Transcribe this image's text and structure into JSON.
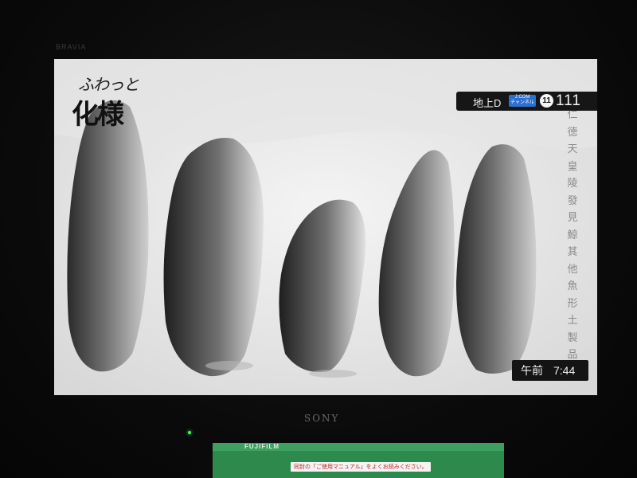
{
  "tv": {
    "brand": "SONY",
    "model_label": "BRAVIA"
  },
  "program": {
    "logo_small": "ふわっと",
    "logo_big": "化様",
    "caption_vertical": "仁徳天皇陵發見鯨其他魚形土製品"
  },
  "channel_overlay": {
    "source": "地上D",
    "provider_line1": "J:COM",
    "provider_line2": "チャンネル",
    "channel_id": "11",
    "channel_number": "111"
  },
  "clock": {
    "ampm": "午前",
    "time": "7:44"
  },
  "foreground_box": {
    "brand": "FUJIFILM",
    "label": "同封の「ご使用マニュアル」をよくお読みください。"
  },
  "colors": {
    "overlay_bg": "#161616",
    "jcom_blue": "#2c6fd1",
    "box_green": "#2e8a4c",
    "led_green": "#3aff5a"
  }
}
